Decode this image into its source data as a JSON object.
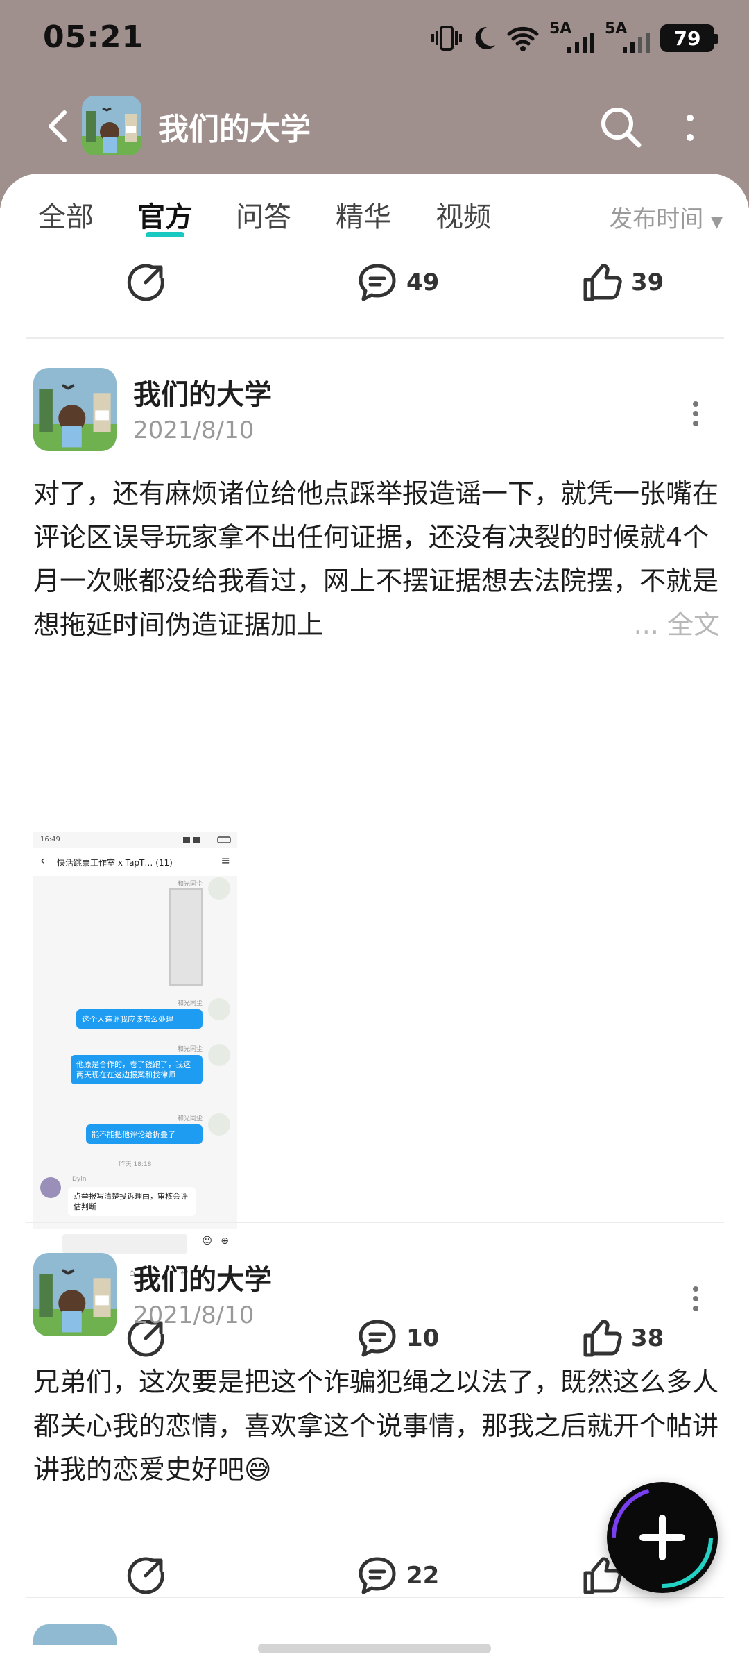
{
  "status_bar": {
    "time": "05:21",
    "signal1_label": "5A",
    "signal2_label": "5A",
    "battery": "79"
  },
  "header": {
    "title": "我们的大学"
  },
  "tabs": [
    {
      "label": "全部"
    },
    {
      "label": "官方"
    },
    {
      "label": "问答"
    },
    {
      "label": "精华"
    },
    {
      "label": "视频"
    }
  ],
  "sort_label": "发布时间",
  "first_actions": {
    "comments": "49",
    "likes": "39"
  },
  "posts": [
    {
      "author": "我们的大学",
      "date": "2021/8/10",
      "text": "对了，还有麻烦诸位给他点踩举报造谣一下，就凭一张嘴在评论区误导玩家拿不出任何证据，还没有决裂的时候就4个月一次账都没给我看过，网上不摆证据想去法院摆，不就是想拖延时间伪造证据加上",
      "more_label": "... 全文",
      "comments": "10",
      "likes": "38",
      "screenshot": {
        "time": "16:49",
        "chat_title": "快活跳票工作室 x TapT… (11)",
        "sender": "和光同尘",
        "msg1": "这个人造谣我应该怎么处理",
        "msg2": "他原是合作的，卷了钱跑了，我这两天现在在这边报案和找律师",
        "msg3": "能不能把他评论给折叠了",
        "timestamp": "昨天 18:18",
        "reply_name": "Dyin",
        "reply": "点举报写清楚投诉理由，审核会评估判断"
      }
    },
    {
      "author": "我们的大学",
      "date": "2021/8/10",
      "text": "兄弟们，这次要是把这个诈骗犯绳之以法了，既然这么多人都关心我的恋情，喜欢拿这个说事情，那我之后就开个帖讲讲我的恋爱史好吧😅",
      "comments": "22"
    }
  ]
}
